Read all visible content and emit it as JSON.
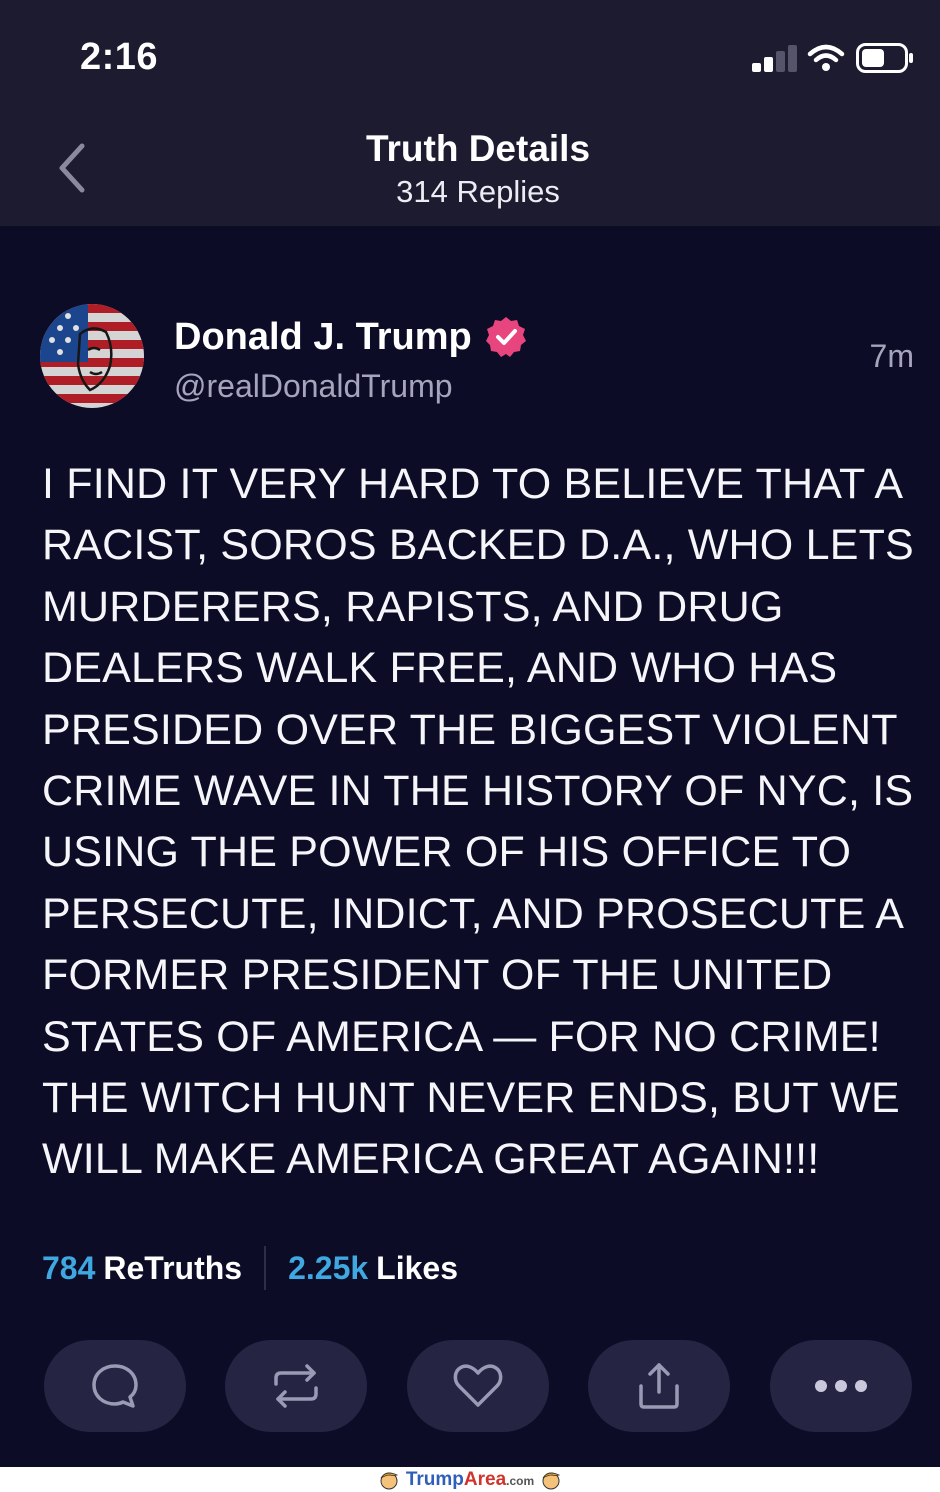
{
  "status_bar": {
    "time": "2:16"
  },
  "nav": {
    "title": "Truth Details",
    "subtitle": "314 Replies"
  },
  "post": {
    "author_name": "Donald J. Trump",
    "handle": "@realDonaldTrump",
    "timestamp": "7m",
    "body": "I FIND IT VERY HARD TO BELIEVE THAT A RACIST, SOROS BACKED D.A., WHO LETS MURDERERS, RAPISTS, AND DRUG DEALERS WALK FREE, AND WHO HAS PRESIDED OVER THE BIGGEST VIOLENT CRIME WAVE IN THE HISTORY OF NYC, IS USING THE POWER OF HIS OFFICE TO PERSECUTE, INDICT, AND PROSECUTE A FORMER PRESIDENT OF THE UNITED STATES OF AMERICA — FOR NO CRIME! THE WITCH HUNT NEVER ENDS, BUT WE WILL MAKE AMERICA GREAT AGAIN!!!",
    "verified_icon": "verified-badge-icon"
  },
  "stats": {
    "retruths_count": "784",
    "retruths_label": "ReTruths",
    "likes_count": "2.25k",
    "likes_label": "Likes"
  },
  "actions": [
    {
      "name": "reply",
      "icon": "comment-bubble-icon"
    },
    {
      "name": "retruth",
      "icon": "repost-arrows-icon"
    },
    {
      "name": "like",
      "icon": "heart-icon"
    },
    {
      "name": "share",
      "icon": "share-upload-icon"
    },
    {
      "name": "more",
      "icon": "more-dots-icon"
    }
  ],
  "watermark": {
    "brand_main": "Trump",
    "brand_accent": "Area",
    "brand_suffix": ".com"
  },
  "colors": {
    "background": "#0d0c26",
    "header": "#1c1b2f",
    "accent_blue": "#3fa8e0",
    "verified_pink": "#e8457f",
    "action_button": "#252443"
  }
}
